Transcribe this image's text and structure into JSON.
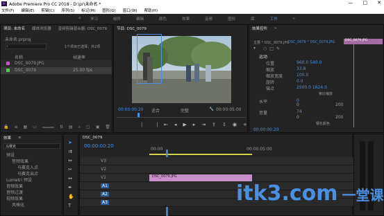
{
  "app": {
    "title": "Adobe Premiere Pro CC 2018 - D:\\pr\\未命名 *",
    "logo": "Pr"
  },
  "window_buttons": [
    "—",
    "□",
    "✕"
  ],
  "menu": [
    "文件(F)",
    "编辑(E)",
    "剪辑(C)",
    "序列(S)",
    "标记(M)",
    "图形(G)",
    "窗口(W)",
    "帮助(H)"
  ],
  "workspaces": [
    "学习",
    "组件",
    "编辑",
    "颜色",
    "效果",
    "音频",
    "图形",
    "库",
    "工作",
    "»"
  ],
  "project": {
    "tabs": [
      "项目: 未命名",
      "媒体浏览器",
      "音频剪辑混合器: DSC_0079"
    ],
    "file": "未命名.prproj",
    "search_placeholder": "",
    "count": "1个项目已选择，共2项",
    "col_name": "名称",
    "col_fps": "帧速率",
    "items": [
      {
        "name": "DSC_0079.JPG",
        "fps": "",
        "color": "#d04cd0"
      },
      {
        "name": "DSC_0079",
        "fps": "25.00 fps",
        "color": "#4cd04c"
      }
    ]
  },
  "program": {
    "title": "节目: DSC_0079",
    "timecode": "00:00:00:20",
    "fit": "适合",
    "quality": "完整",
    "duration": "00:00:05:00"
  },
  "effect_controls": {
    "tabs": [
      "效果控件",
      "Lumetri 范围",
      "源: (无剪辑)",
      "音频剪辑混合器: DSC_0079"
    ],
    "master": "主要 * DSC_0079.JPG",
    "clip": "DSC_0079 * DSC_0079.JPG",
    "clip_bar": "DSC_0079.JPG",
    "section_motion": "运动",
    "props": [
      {
        "name": "位置",
        "value": "960.0  540.0"
      },
      {
        "name": "缩放",
        "value": "33.8"
      },
      {
        "name": "缩放宽度",
        "value": "100.0"
      },
      {
        "name": "旋转",
        "value": "0.0"
      },
      {
        "name": "锚点",
        "value": "2500.0  1624.0"
      },
      {
        "name": "防闪烁滤镜",
        "value": "0.00"
      }
    ],
    "uniform_scale": "等比缩放",
    "pitch_label": "水平",
    "pitch_value": "0",
    "range_min": "0",
    "range_max": "200",
    "range_mid": "200",
    "pitch2": "音量",
    "pitch2_val": "74",
    "checkbox2": "钢化颜色",
    "timecode": "00:00:00:20"
  },
  "effects": {
    "title": "效果",
    "tab2": "≡",
    "search": "马赛克",
    "tree": [
      "预设",
      "音频效果",
      "马赛克入点",
      "马赛克出点",
      "Lumetri 预设",
      "音频效果",
      "音频过渡",
      "视频效果",
      "风格化"
    ]
  },
  "timeline": {
    "title": "DSC_0079",
    "timecode": "00:00:00:20",
    "ruler": [
      "00:00",
      "00:00:05:00"
    ],
    "tracks": [
      {
        "name": "V3"
      },
      {
        "name": "V2"
      },
      {
        "name": "V1"
      },
      {
        "name": "A1"
      },
      {
        "name": "A2"
      },
      {
        "name": "A3"
      }
    ],
    "clip": "DSC_0079.JPG"
  },
  "watermark": {
    "text": "itk3.com",
    "cn": "一堂课"
  },
  "colors": {
    "accent": "#4a8fe0",
    "panel": "#232323",
    "bg": "#1d1d1d",
    "clip": "#c78fc7"
  }
}
